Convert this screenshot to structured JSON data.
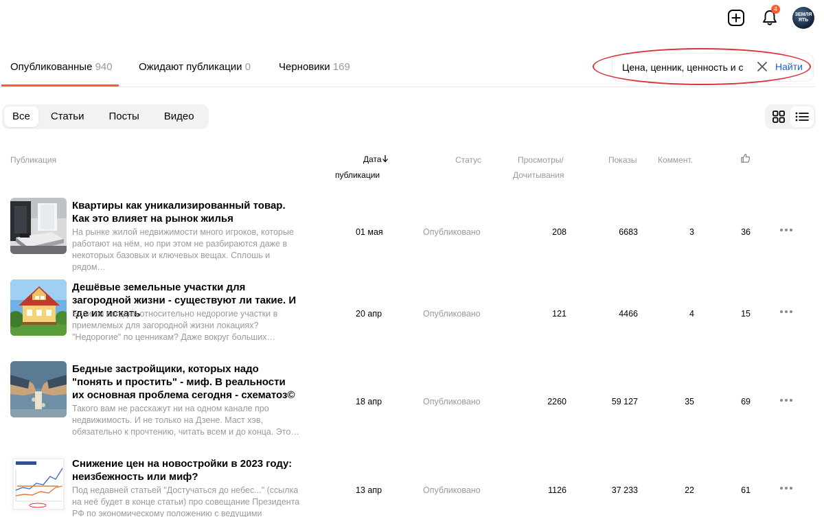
{
  "header": {
    "notification_count": "4",
    "avatar_text_line1": "ЗЕМЛЯ",
    "avatar_text_line2": "ЯТЬ"
  },
  "tabs": [
    {
      "label": "Опубликованные",
      "count": "940"
    },
    {
      "label": "Ожидают публикации",
      "count": "0"
    },
    {
      "label": "Черновики",
      "count": "169"
    }
  ],
  "search": {
    "value": "Цена, ценник, ценность и стоимость",
    "button_label": "Найти"
  },
  "filters": [
    "Все",
    "Статьи",
    "Посты",
    "Видео"
  ],
  "table_header": {
    "publication": "Публикация",
    "date_line1": "Дата",
    "date_line2": "публикации",
    "status": "Статус",
    "views_line1": "Просмотры/",
    "views_line2": "Дочитывания",
    "impressions": "Показы",
    "comments": "Коммент."
  },
  "rows": [
    {
      "title": "Квартиры как уникализированный товар. Как это влияет на рынок жилья",
      "desc": "На рынке жилой недвижимости много игроков, которые работают на нём, но при этом не разбираются даже в некоторых базовых и ключевых вещах. Сплошь и рядом…",
      "date": "01 мая",
      "status": "Опубликовано",
      "views": "208",
      "impressions": "6683",
      "comments": "3",
      "likes": "36"
    },
    {
      "title": "Дешёвые земельные участки для загородной жизни - существуют ли такие. И где их искать",
      "desc": "Если ли сегодня относительно недорогие участки в приемлемых для загородной жизни локациях? \"Недорогие\" по ценникам? Даже вокруг больших…",
      "date": "20 апр",
      "status": "Опубликовано",
      "views": "121",
      "impressions": "4466",
      "comments": "4",
      "likes": "15"
    },
    {
      "title": "Бедные застройщики, которых надо \"понять и простить\" - миф. В реальности их основная проблема сегодня - схематоз©",
      "desc": "Такого вам не расскажут ни на одном канале про недвижимость. И не только на Дзене. Маст хэв, обязательно к прочтению, читать всем и до конца. Это…",
      "date": "18 апр",
      "status": "Опубликовано",
      "views": "2260",
      "impressions": "59 127",
      "comments": "35",
      "likes": "69"
    },
    {
      "title": "Снижение цен на новостройки в 2023 году: неизбежность или миф?",
      "desc": "Под недавней статьей \"Достучаться до небес...\" (ссылка на неё будет в конце статьи) про совещание Президента РФ по экономическому положению с ведущими членами…",
      "date": "13 апр",
      "status": "Опубликовано",
      "views": "1126",
      "impressions": "37 233",
      "comments": "22",
      "likes": "61"
    }
  ],
  "colors": {
    "accent": "#ff5a2b",
    "link": "#1a5fd8",
    "highlight_ellipse": "#d9343a"
  }
}
